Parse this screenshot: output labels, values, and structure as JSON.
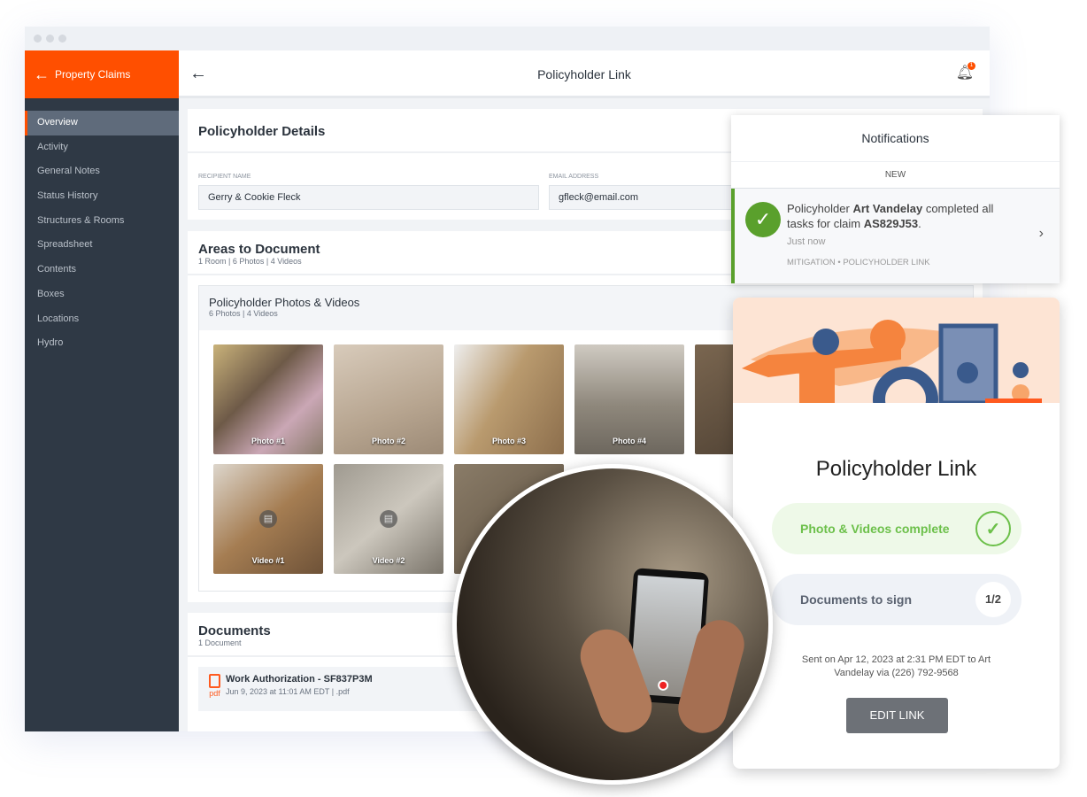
{
  "sidebar": {
    "title": "Property Claims",
    "items": [
      {
        "label": "Overview",
        "active": true
      },
      {
        "label": "Activity"
      },
      {
        "label": "General Notes"
      },
      {
        "label": "Status History"
      },
      {
        "label": "Structures & Rooms"
      },
      {
        "label": "Spreadsheet"
      },
      {
        "label": "Contents"
      },
      {
        "label": "Boxes"
      },
      {
        "label": "Locations"
      },
      {
        "label": "Hydro"
      }
    ]
  },
  "header": {
    "title": "Policyholder Link",
    "notification_count": "1"
  },
  "details": {
    "title": "Policyholder Details",
    "recipient_label": "Recipient Name",
    "recipient_value": "Gerry & Cookie Fleck",
    "email_label": "Email Address",
    "email_value": "gfleck@email.com"
  },
  "areas": {
    "title": "Areas to Document",
    "summary": "1 Room | 6 Photos | 4 Videos",
    "group_title": "Policyholder Photos & Videos",
    "group_summary": "6 Photos | 4 Videos",
    "media": [
      {
        "label": "Photo #1",
        "type": "photo"
      },
      {
        "label": "Photo #2",
        "type": "photo"
      },
      {
        "label": "Photo #3",
        "type": "photo"
      },
      {
        "label": "Photo #4",
        "type": "photo"
      },
      {
        "label": "",
        "type": "photo"
      },
      {
        "label": "Video #1",
        "type": "video"
      },
      {
        "label": "Video #2",
        "type": "video"
      },
      {
        "label": "",
        "type": "video"
      }
    ]
  },
  "documents": {
    "title": "Documents",
    "summary": "1 Document",
    "items": [
      {
        "name": "Work Authorization - SF837P3M",
        "meta": "Jun 9, 2023 at 11:01 AM EDT | .pdf",
        "icon_label": "pdf"
      }
    ]
  },
  "notifications": {
    "title": "Notifications",
    "section": "NEW",
    "item": {
      "prefix": "Policyholder ",
      "name": "Art Vandelay",
      "middle": " completed all tasks for claim ",
      "claim": "AS829J53",
      "suffix": ".",
      "time": "Just now",
      "tag1": "MITIGATION",
      "tag2": "POLICYHOLDER LINK"
    }
  },
  "link_card": {
    "title": "Policyholder Link",
    "photos_status": "Photo & Videos complete",
    "docs_label": "Documents to sign",
    "docs_progress": "1/2",
    "sent_text": "Sent on Apr 12, 2023 at 2:31 PM EDT to Art Vandelay via (226) 792-9568",
    "edit_button": "EDIT LINK"
  },
  "colors": {
    "brand": "#ff4f00",
    "sidebar": "#2f3945",
    "success": "#5aa02c",
    "success_text": "#6cc04a"
  }
}
